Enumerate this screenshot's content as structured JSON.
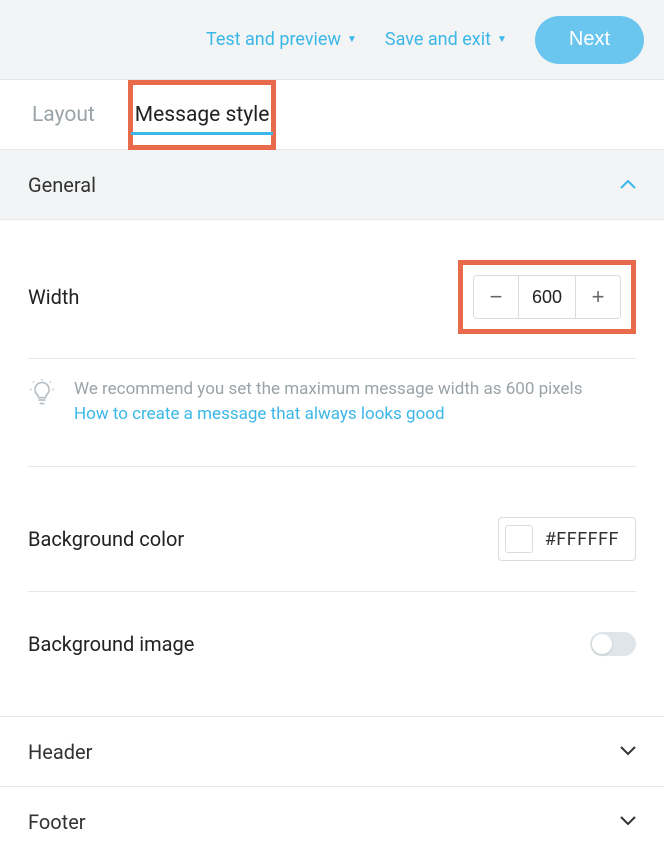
{
  "toolbar": {
    "test_preview": "Test and preview",
    "save_exit": "Save and exit",
    "next": "Next"
  },
  "tabs": {
    "layout": "Layout",
    "message_style": "Message style"
  },
  "sections": {
    "general": "General",
    "header": "Header",
    "footer": "Footer"
  },
  "width": {
    "label": "Width",
    "value": "600"
  },
  "tip": {
    "text": "We recommend you set the maximum message width as 600 pixels",
    "link": "How to create a message that always looks good"
  },
  "bg_color": {
    "label": "Background color",
    "value": "#FFFFFF"
  },
  "bg_image": {
    "label": "Background image",
    "enabled": false
  }
}
